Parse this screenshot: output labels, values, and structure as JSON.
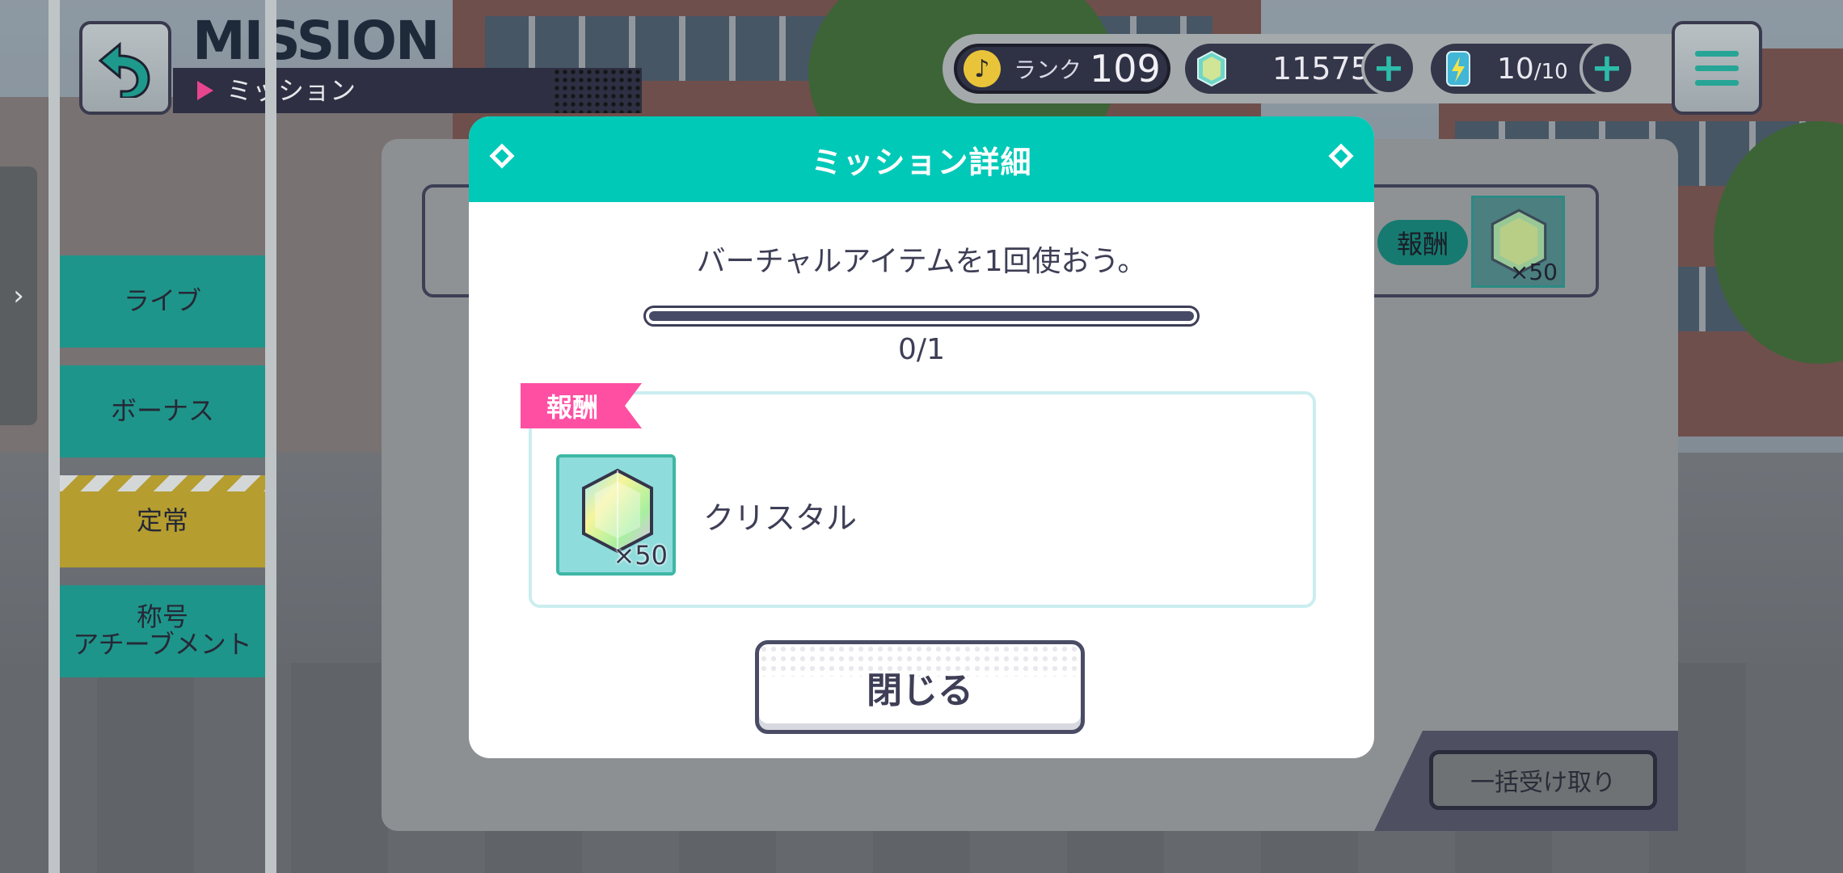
{
  "header": {
    "title": "MISSION",
    "subtitle": "ミッション"
  },
  "status": {
    "rank_label": "ランク",
    "rank_value": "109",
    "crystals": "11575",
    "energy_current": "10",
    "energy_max": "/10"
  },
  "nav": {
    "items": [
      {
        "label": "ライブ"
      },
      {
        "label": "ボーナス"
      },
      {
        "label": "定常"
      },
      {
        "label": "称号\nアチーブメント"
      }
    ]
  },
  "background_row": {
    "reward_badge": "報酬",
    "reward_qty": "×50"
  },
  "bulk_button": "一括受け取り",
  "modal": {
    "title": "ミッション詳細",
    "mission_text": "バーチャルアイテムを1回使おう。",
    "progress_text": "0/1",
    "progress_fraction": 0,
    "reward_tag": "報酬",
    "reward_qty": "×50",
    "reward_name": "クリスタル",
    "close_label": "閉じる"
  },
  "colors": {
    "accent": "#00c9b8",
    "reward_tag": "#ff4fa3",
    "dark": "#3e3e56"
  }
}
